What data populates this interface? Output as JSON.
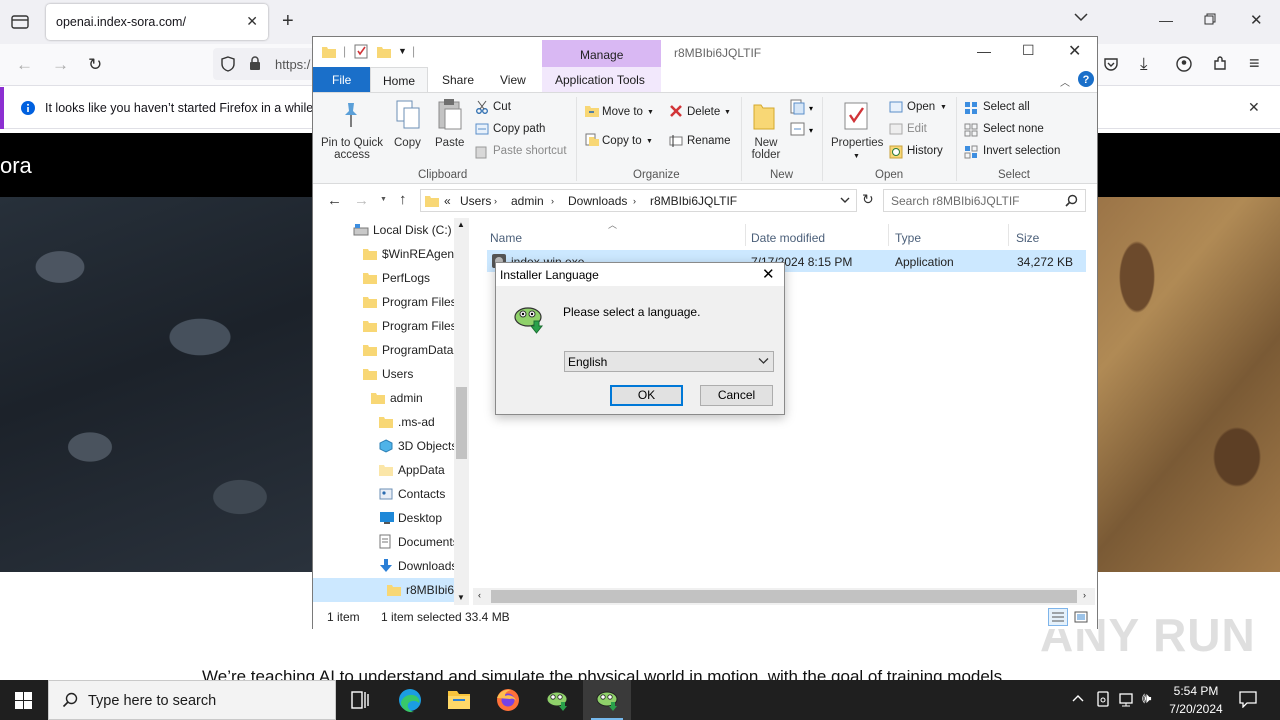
{
  "browser": {
    "tab_title": "openai.index-sora.com/",
    "url_partial": "https:/",
    "notification": "It looks like you haven’t started Firefox in a while. D"
  },
  "website": {
    "brand_partial": "ora",
    "body_text": "We’re teaching AI to understand and simulate the physical world in motion, with the goal of training models"
  },
  "watermark": "ANY RUN",
  "explorer": {
    "title": "r8MBIbi6JQLTIF",
    "manage_tab": "Manage",
    "app_tools_tab": "Application Tools",
    "ribbon_tabs": [
      "File",
      "Home",
      "Share",
      "View"
    ],
    "clipboard": {
      "pin": "Pin to Quick access",
      "pin_line1": "Pin to Quick",
      "pin_line2": "access",
      "copy": "Copy",
      "paste": "Paste",
      "cut": "Cut",
      "copy_path": "Copy path",
      "paste_shortcut": "Paste shortcut",
      "group": "Clipboard"
    },
    "organize": {
      "move_to": "Move to",
      "copy_to": "Copy to",
      "delete": "Delete",
      "rename": "Rename",
      "group": "Organize"
    },
    "new": {
      "new_folder_line1": "New",
      "new_folder_line2": "folder",
      "group": "New"
    },
    "open": {
      "properties": "Properties",
      "open": "Open",
      "edit": "Edit",
      "history": "History",
      "group": "Open"
    },
    "select": {
      "select_all": "Select all",
      "select_none": "Select none",
      "invert": "Invert selection",
      "group": "Select"
    },
    "breadcrumb": [
      "«",
      "Users",
      "admin",
      "Downloads",
      "r8MBIbi6JQLTIF"
    ],
    "search_placeholder": "Search r8MBIbi6JQLTIF",
    "nav_items": [
      "Local Disk (C:)",
      "$WinREAgent",
      "PerfLogs",
      "Program Files",
      "Program Files",
      "ProgramData",
      "Users",
      "admin",
      ".ms-ad",
      "3D Objects",
      "AppData",
      "Contacts",
      "Desktop",
      "Documents",
      "Downloads",
      "r8MBIbi6"
    ],
    "columns": [
      "Name",
      "Date modified",
      "Type",
      "Size"
    ],
    "file": {
      "name": "index-win.exe",
      "date": "7/17/2024 8:15 PM",
      "type": "Application",
      "size": "34,272 KB"
    },
    "status": {
      "count": "1 item",
      "selected": "1 item selected",
      "size": "33.4 MB"
    }
  },
  "dialog": {
    "title": "Installer Language",
    "message": "Please select a language.",
    "selected_language": "English",
    "ok": "OK",
    "cancel": "Cancel"
  },
  "taskbar": {
    "search_placeholder": "Type here to search",
    "time": "5:54 PM",
    "date": "7/20/2024"
  },
  "colors": {
    "accent": "#0078d7",
    "manage_tab": "#d9b8f3",
    "file_tab": "#1a6fc9",
    "selection": "#cce8ff",
    "taskbar": "#1f1f1f"
  }
}
